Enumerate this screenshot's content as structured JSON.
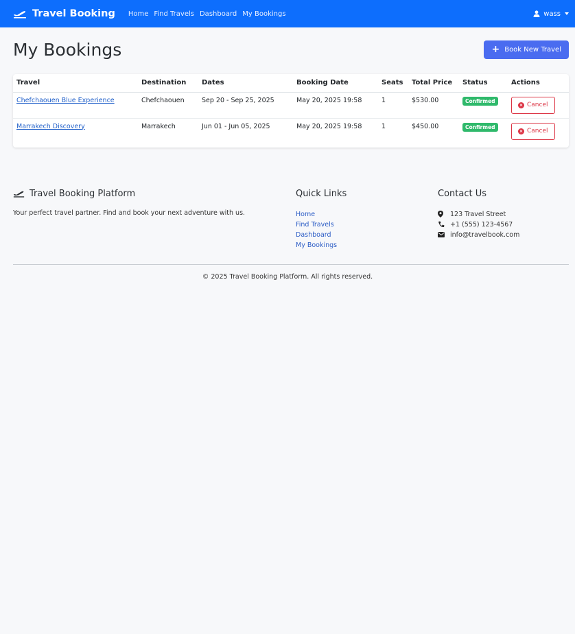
{
  "navbar": {
    "brand": "Travel Booking",
    "links": [
      "Home",
      "Find Travels",
      "Dashboard",
      "My Bookings"
    ],
    "user": "wass"
  },
  "page": {
    "title": "My Bookings",
    "new_button": "Book New Travel"
  },
  "table": {
    "headers": [
      "Travel",
      "Destination",
      "Dates",
      "Booking Date",
      "Seats",
      "Total Price",
      "Status",
      "Actions"
    ],
    "rows": [
      {
        "travel": "Chefchaouen Blue Experience",
        "destination": "Chefchaouen",
        "dates": "Sep 20 - Sep 25, 2025",
        "booking_date": "May 20, 2025 19:58",
        "seats": "1",
        "price": "$530.00",
        "status": "Confirmed",
        "action": "Cancel"
      },
      {
        "travel": "Marrakech Discovery",
        "destination": "Marrakech",
        "dates": "Jun 01 - Jun 05, 2025",
        "booking_date": "May 20, 2025 19:58",
        "seats": "1",
        "price": "$450.00",
        "status": "Confirmed",
        "action": "Cancel"
      }
    ]
  },
  "footer": {
    "brand_title": "Travel Booking Platform",
    "brand_text": "Your perfect travel partner. Find and book your next adventure with us.",
    "links_title": "Quick Links",
    "links": [
      "Home",
      "Find Travels",
      "Dashboard",
      "My Bookings"
    ],
    "contact_title": "Contact Us",
    "address": "123 Travel Street",
    "phone": "+1 (555) 123-4567",
    "email": "info@travelbook.com",
    "copyright": "© 2025 Travel Booking Platform. All rights reserved."
  },
  "colors": {
    "navbar": "#0d6efd",
    "primary_button": "#4a6cf0",
    "status_confirmed": "#2fb96b",
    "cancel": "#dc3545"
  },
  "icons": [
    "plane-icon",
    "user-icon",
    "plus-icon",
    "x-circle-icon",
    "map-marker-icon",
    "phone-icon",
    "envelope-icon"
  ]
}
